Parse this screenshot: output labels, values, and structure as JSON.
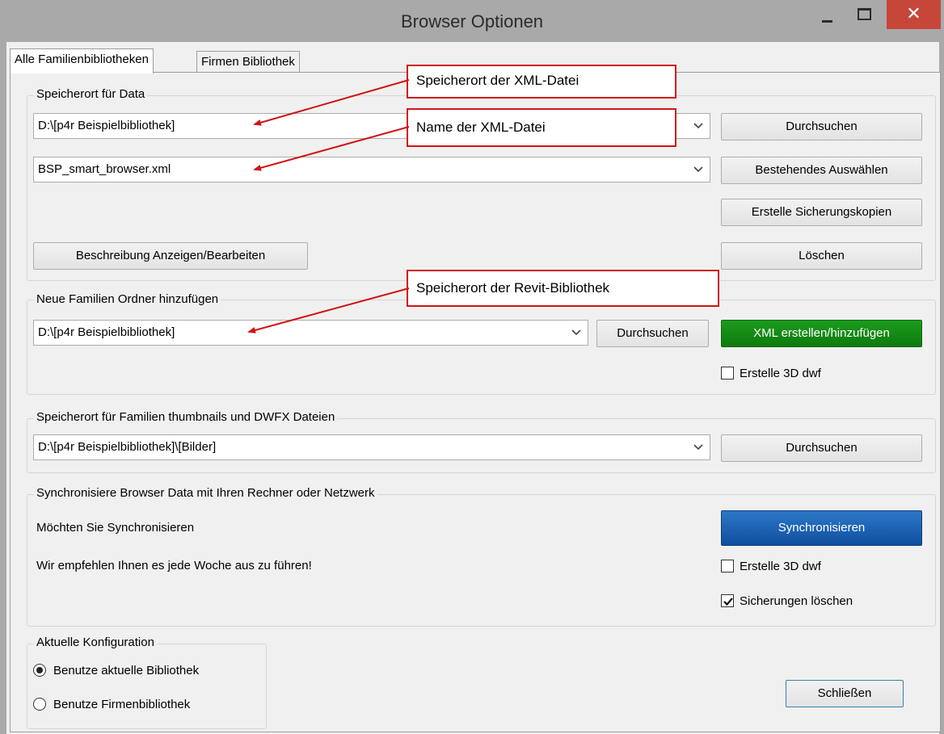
{
  "window": {
    "title": "Browser Optionen",
    "close_glyph": "✕"
  },
  "tabs": [
    {
      "label": "Alle Familienbibliotheken",
      "active": true
    },
    {
      "label": "Firmen Bibliothek",
      "active": false
    }
  ],
  "storage_group": {
    "label": "Speicherort für Data",
    "path_value": "D:\\[p4r Beispielbibliothek]",
    "file_value": "BSP_smart_browser.xml",
    "browse_label": "Durchsuchen",
    "select_existing_label": "Bestehendes Auswählen",
    "backup_label": "Erstelle Sicherungskopien",
    "description_label": "Beschreibung Anzeigen/Bearbeiten",
    "delete_label": "Löschen"
  },
  "new_folders_group": {
    "label": "Neue Familien Ordner hinzufügen",
    "path_value": "D:\\[p4r Beispielbibliothek]",
    "browse_label": "Durchsuchen",
    "create_xml_label": "XML erstellen/hinzufügen",
    "create_3d_label": "Erstelle 3D dwf",
    "create_3d_checked": false
  },
  "thumbnails_group": {
    "label": "Speicherort für Familien thumbnails und DWFX Dateien",
    "path_value": "D:\\[p4r Beispielbibliothek]\\[Bilder]",
    "browse_label": "Durchsuchen"
  },
  "sync_group": {
    "label": "Synchronisiere Browser Data mit Ihren Rechner oder Netzwerk",
    "question": "Möchten Sie Synchronisieren",
    "recommendation": "Wir empfehlen Ihnen es jede Woche aus zu führen!",
    "sync_label": "Synchronisieren",
    "create_3d_label": "Erstelle 3D dwf",
    "create_3d_checked": false,
    "delete_backups_label": "Sicherungen löschen",
    "delete_backups_checked": true
  },
  "config_group": {
    "label": "Aktuelle Konfiguration",
    "options": [
      {
        "label": "Benutze aktuelle Bibliothek",
        "selected": true
      },
      {
        "label": "Benutze Firmenbibliothek",
        "selected": false
      }
    ]
  },
  "footer": {
    "close_label": "Schließen"
  },
  "callouts": {
    "xml_location": "Speicherort der XML-Datei",
    "xml_name": "Name der XML-Datei",
    "revit_location": "Speicherort der Revit-Bibliothek"
  },
  "colors": {
    "callout_border": "#d21414",
    "close_button": "#c7463a",
    "xml_button": "#0f7a0f",
    "sync_button": "#0f4f9e"
  }
}
